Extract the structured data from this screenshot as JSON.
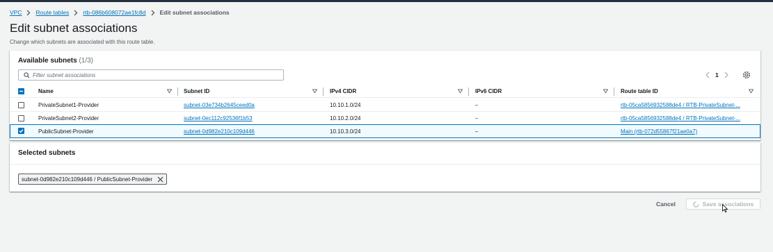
{
  "breadcrumb": {
    "items": [
      "VPC",
      "Route tables",
      "rtb-086b608072ae1fc8d"
    ],
    "current": "Edit subnet associations"
  },
  "page": {
    "title": "Edit subnet associations",
    "description": "Change which subnets are associated with this route table."
  },
  "available": {
    "title": "Available subnets",
    "count": "(1/3)",
    "filter_placeholder": "Filter subnet associations",
    "page_number": "1",
    "columns": [
      "Name",
      "Subnet ID",
      "IPv4 CIDR",
      "IPv6 CIDR",
      "Route table ID"
    ],
    "rows": [
      {
        "name": "PrivateSubnet1-Provider",
        "subnet_id": "subnet-03e734b2645ceed0a",
        "ipv4": "10.10.1.0/24",
        "ipv6": "–",
        "route_table": "rtb-05ca5856932588de4 / RTB-PrivateSubnet-...",
        "checked": false
      },
      {
        "name": "PrivateSubnet2-Provider",
        "subnet_id": "subnet-0ec112c92536f1b53",
        "ipv4": "10.10.2.0/24",
        "ipv6": "–",
        "route_table": "rtb-05ca5856932588de4 / RTB-PrivateSubnet-...",
        "checked": false
      },
      {
        "name": "PublicSubnet-Provider",
        "subnet_id": "subnet-0d982e210c109d446",
        "ipv4": "10.10.3.0/24",
        "ipv6": "–",
        "route_table": "Main (rtb-072d55867f21ae0a7)",
        "checked": true
      }
    ]
  },
  "selected": {
    "title": "Selected subnets",
    "tokens": [
      "subnet-0d982e210c109d446 / PublicSubnet-Provider"
    ]
  },
  "footer": {
    "cancel_label": "Cancel",
    "save_label": "Save associations"
  },
  "colors": {
    "link": "#0073bb",
    "selected_row_bg": "#f1faff",
    "selected_row_border": "#0073bb",
    "page_bg": "#f2f3f3",
    "disabled_text": "#aab7b8"
  }
}
